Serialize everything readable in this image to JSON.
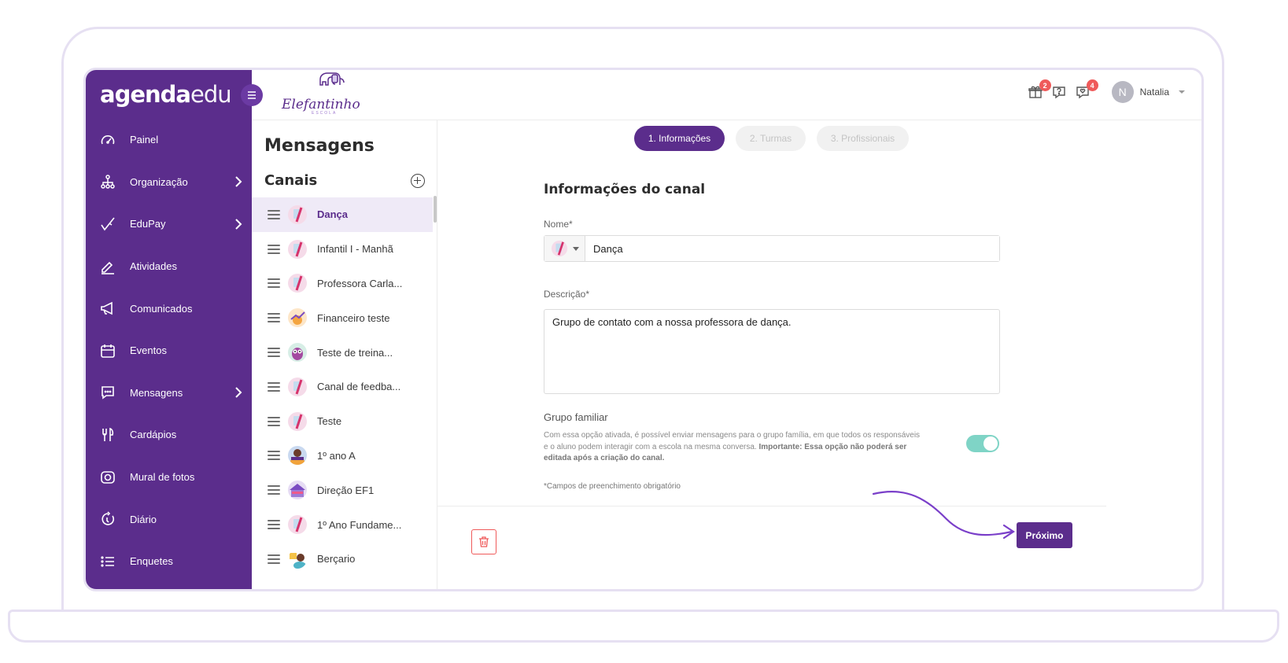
{
  "brand": {
    "bold": "agenda",
    "light": "edu"
  },
  "school": {
    "name": "Elefantinho",
    "tagline": "ESCOLA"
  },
  "sidebar": {
    "items": [
      {
        "label": "Painel",
        "icon": "gauge-icon",
        "has_submenu": false
      },
      {
        "label": "Organização",
        "icon": "org-chart-icon",
        "has_submenu": true
      },
      {
        "label": "EduPay",
        "icon": "check-pen-icon",
        "has_submenu": true
      },
      {
        "label": "Atividades",
        "icon": "pencil-icon",
        "has_submenu": false
      },
      {
        "label": "Comunicados",
        "icon": "megaphone-icon",
        "has_submenu": false
      },
      {
        "label": "Eventos",
        "icon": "calendar-icon",
        "has_submenu": false
      },
      {
        "label": "Mensagens",
        "icon": "chat-icon",
        "has_submenu": true
      },
      {
        "label": "Cardápios",
        "icon": "cutlery-icon",
        "has_submenu": false
      },
      {
        "label": "Mural de fotos",
        "icon": "camera-icon",
        "has_submenu": false
      },
      {
        "label": "Diário",
        "icon": "refresh-icon",
        "has_submenu": false
      },
      {
        "label": "Enquetes",
        "icon": "list-icon",
        "has_submenu": false
      }
    ]
  },
  "topbar": {
    "gift_badge": "2",
    "chat_badge": "4",
    "user_initial": "N",
    "user_name": "Natalia"
  },
  "channels": {
    "title": "Mensagens",
    "subtitle": "Canais",
    "items": [
      {
        "label": "Dança",
        "active": true
      },
      {
        "label": "Infantil I - Manhã",
        "active": false
      },
      {
        "label": "Professora Carla...",
        "active": false
      },
      {
        "label": "Financeiro teste",
        "active": false
      },
      {
        "label": "Teste de treina...",
        "active": false
      },
      {
        "label": "Canal de feedba...",
        "active": false
      },
      {
        "label": "Teste",
        "active": false
      },
      {
        "label": "1º ano A",
        "active": false
      },
      {
        "label": "Direção EF1",
        "active": false
      },
      {
        "label": "1º Ano Fundame...",
        "active": false
      },
      {
        "label": "Berçario",
        "active": false
      }
    ]
  },
  "steps": {
    "s1": "1. Informações",
    "s2": "2. Turmas",
    "s3": "3. Profissionais"
  },
  "form": {
    "title": "Informações do canal",
    "name_label": "Nome*",
    "name_value": "Dança",
    "desc_label": "Descrição*",
    "desc_value": "Grupo de contato com a nossa professora de dança.",
    "family_title": "Grupo familiar",
    "family_desc": "Com essa opção ativada, é possível enviar mensagens para o grupo família, em que todos os responsáveis e o aluno podem interagir com a escola na mesma conversa.",
    "family_desc_bold": "Importante: Essa opção não poderá ser editada após a criação do canal.",
    "family_enabled": true,
    "required_note": "*Campos de preenchimento obrigatório",
    "next_label": "Próximo"
  },
  "colors": {
    "primary": "#5b2d8c",
    "active_bg": "#efeaf7",
    "toggle_on": "#7fd4c6",
    "badge": "#ef5a5a",
    "delete": "#ef5a5a",
    "frame": "#e6e0f2"
  }
}
